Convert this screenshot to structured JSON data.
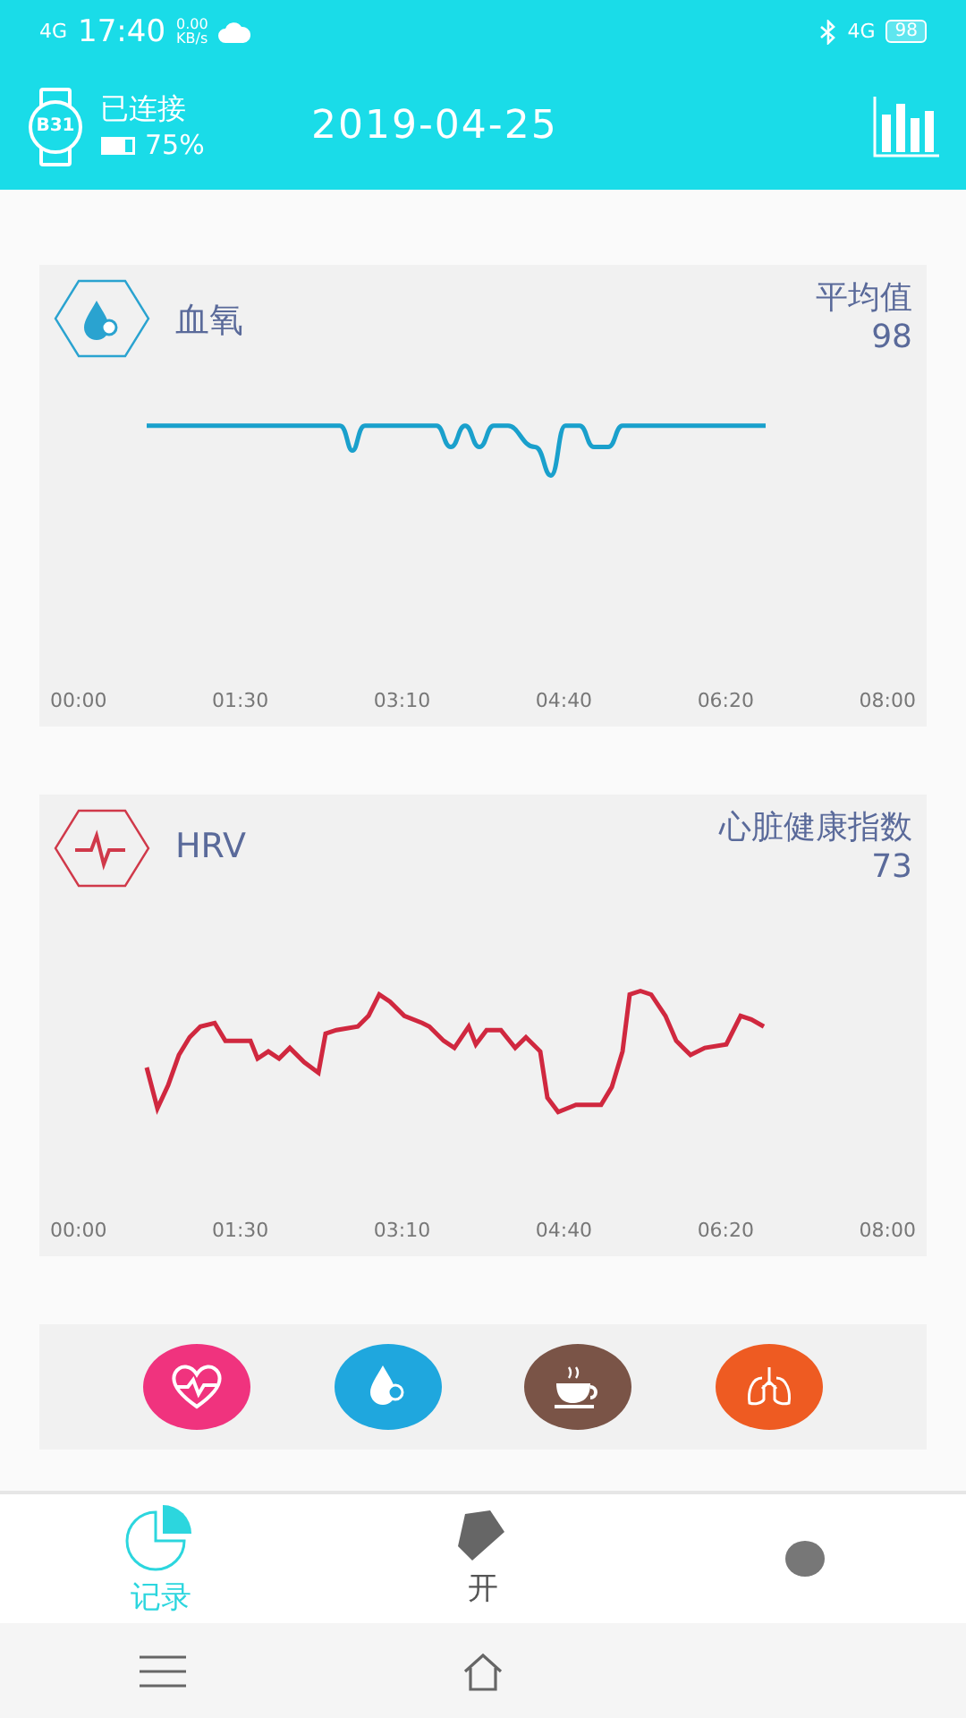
{
  "status_bar": {
    "network_left": "4G",
    "time": "17:40",
    "speed_value": "0.00",
    "speed_unit": "KB/s",
    "network_right": "4G",
    "battery": "98"
  },
  "header": {
    "device": "B31",
    "connection": "已连接",
    "battery": {
      "percent": "75%",
      "level": 0.75
    },
    "date": "2019-04-25"
  },
  "cards": [
    {
      "kind": "oxygen",
      "title": "血氧",
      "stat_label": "平均值",
      "stat_value": "98",
      "x_labels": [
        "00:00",
        "01:30",
        "03:10",
        "04:40",
        "06:20",
        "08:00"
      ]
    },
    {
      "kind": "hrv",
      "title": "HRV",
      "stat_label": "心脏健康指数",
      "stat_value": "73",
      "x_labels": [
        "00:00",
        "01:30",
        "03:10",
        "04:40",
        "06:20",
        "08:00"
      ]
    }
  ],
  "shortcuts": [
    {
      "kind": "heart",
      "color": "#f0337e"
    },
    {
      "kind": "oxygen",
      "color": "#1fa7de"
    },
    {
      "kind": "coffee",
      "color": "#7a5447"
    },
    {
      "kind": "lungs",
      "color": "#ee5b22"
    }
  ],
  "tabs": [
    {
      "kind": "record",
      "label": "记录",
      "selected": true
    },
    {
      "kind": "exercise",
      "label": "开",
      "selected": false
    },
    {
      "kind": "profile",
      "selected": false
    }
  ]
}
